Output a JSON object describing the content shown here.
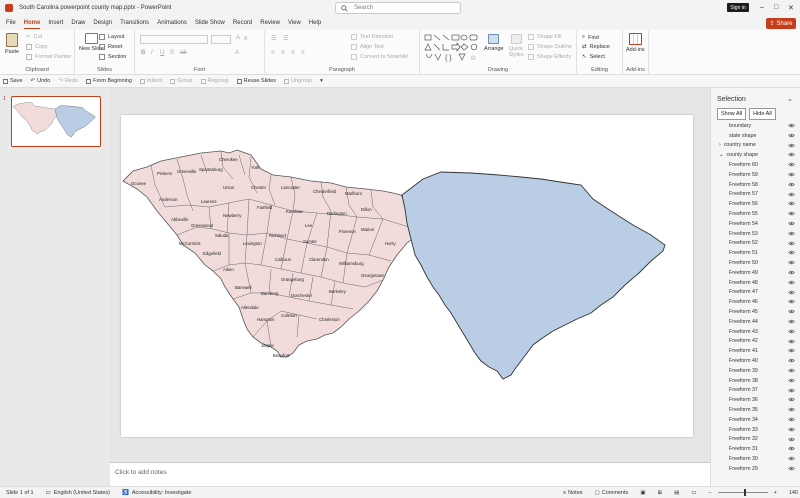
{
  "app": {
    "window_title": "South Carolina powerpoint county map.pptx  -  PowerPoint",
    "search_placeholder": "Search",
    "sign_in": "Sign in",
    "share": "Share"
  },
  "menu": [
    "File",
    "Home",
    "Insert",
    "Draw",
    "Design",
    "Transitions",
    "Animations",
    "Slide Show",
    "Record",
    "Review",
    "View",
    "Help"
  ],
  "active_menu": "Home",
  "ribbon": {
    "clipboard": {
      "label": "Clipboard",
      "paste": "Paste",
      "cut": "Cut",
      "copy": "Copy",
      "format_painter": "Format Painter"
    },
    "slides": {
      "label": "Slides",
      "new_slide": "New Slide",
      "layout": "Layout",
      "reset": "Reset",
      "section": "Section"
    },
    "font": {
      "label": "Font"
    },
    "paragraph": {
      "label": "Paragraph",
      "text_direction": "Text Direction",
      "align_text": "Align Text",
      "convert_smartart": "Convert to SmartArt"
    },
    "drawing": {
      "label": "Drawing",
      "arrange": "Arrange",
      "quick_styles": "Quick Styles",
      "shape_fill": "Shape Fill",
      "shape_outline": "Shape Outline",
      "shape_effects": "Shape Effects"
    },
    "editing": {
      "label": "Editing",
      "find": "Find",
      "replace": "Replace",
      "select": "Select"
    },
    "addins": {
      "label": "Add-ins",
      "addins": "Add-ins"
    }
  },
  "qat": {
    "save": "Save",
    "undo": "Undo",
    "redo": "Redo",
    "from_beginning": "From Beginning",
    "indent": "Indent",
    "group": "Group",
    "regroup": "Regroup",
    "reuse_slides": "Reuse Slides",
    "ungroup": "Ungroup"
  },
  "thumbnail": {
    "number": "1"
  },
  "notes_placeholder": "Click to add notes",
  "selection_pane": {
    "title": "Selection",
    "show_all": "Show All",
    "hide_all": "Hide All",
    "items": [
      {
        "label": "boundary",
        "indent": 2,
        "expander": ""
      },
      {
        "label": "state shape",
        "indent": 2,
        "expander": ""
      },
      {
        "label": "country name",
        "indent": 1,
        "expander": ">"
      },
      {
        "label": "county shape",
        "indent": 1,
        "expander": "v"
      },
      {
        "label": "Freeform 60",
        "indent": 2,
        "expander": ""
      },
      {
        "label": "Freeform 59",
        "indent": 2,
        "expander": ""
      },
      {
        "label": "Freeform 58",
        "indent": 2,
        "expander": ""
      },
      {
        "label": "Freeform 57",
        "indent": 2,
        "expander": ""
      },
      {
        "label": "Freeform 56",
        "indent": 2,
        "expander": ""
      },
      {
        "label": "Freeform 55",
        "indent": 2,
        "expander": ""
      },
      {
        "label": "Freeform 54",
        "indent": 2,
        "expander": ""
      },
      {
        "label": "Freeform 53",
        "indent": 2,
        "expander": ""
      },
      {
        "label": "Freeform 52",
        "indent": 2,
        "expander": ""
      },
      {
        "label": "Freeform 51",
        "indent": 2,
        "expander": ""
      },
      {
        "label": "Freeform 50",
        "indent": 2,
        "expander": ""
      },
      {
        "label": "Freeform 49",
        "indent": 2,
        "expander": ""
      },
      {
        "label": "Freeform 48",
        "indent": 2,
        "expander": ""
      },
      {
        "label": "Freeform 47",
        "indent": 2,
        "expander": ""
      },
      {
        "label": "Freeform 46",
        "indent": 2,
        "expander": ""
      },
      {
        "label": "Freeform 45",
        "indent": 2,
        "expander": ""
      },
      {
        "label": "Freeform 44",
        "indent": 2,
        "expander": ""
      },
      {
        "label": "Freeform 43",
        "indent": 2,
        "expander": ""
      },
      {
        "label": "Freeform 42",
        "indent": 2,
        "expander": ""
      },
      {
        "label": "Freeform 41",
        "indent": 2,
        "expander": ""
      },
      {
        "label": "Freeform 40",
        "indent": 2,
        "expander": ""
      },
      {
        "label": "Freeform 39",
        "indent": 2,
        "expander": ""
      },
      {
        "label": "Freeform 38",
        "indent": 2,
        "expander": ""
      },
      {
        "label": "Freeform 37",
        "indent": 2,
        "expander": ""
      },
      {
        "label": "Freeform 36",
        "indent": 2,
        "expander": ""
      },
      {
        "label": "Freeform 35",
        "indent": 2,
        "expander": ""
      },
      {
        "label": "Freeform 34",
        "indent": 2,
        "expander": ""
      },
      {
        "label": "Freeform 33",
        "indent": 2,
        "expander": ""
      },
      {
        "label": "Freeform 32",
        "indent": 2,
        "expander": ""
      },
      {
        "label": "Freeform 31",
        "indent": 2,
        "expander": ""
      },
      {
        "label": "Freeform 30",
        "indent": 2,
        "expander": ""
      },
      {
        "label": "Freeform 29",
        "indent": 2,
        "expander": ""
      }
    ]
  },
  "status": {
    "slide": "Slide 1 of 1",
    "language": "English (United States)",
    "accessibility": "Accessibility: Investigate",
    "notes": "Notes",
    "comments": "Comments",
    "zoom": "140"
  },
  "map": {
    "county_fill": "#f2dcdb",
    "state_fill": "#b9cde5",
    "counties": [
      "Oconee",
      "Pickens",
      "Greenville",
      "Cherokee",
      "Spartanburg",
      "York",
      "Union",
      "Chester",
      "Lancaster",
      "Chesterfield",
      "Marlboro",
      "Anderson",
      "Laurens",
      "Abbeville",
      "Greenwood",
      "Newberry",
      "Fairfield",
      "Kershaw",
      "Darlington",
      "Dillon",
      "Lee",
      "Florence",
      "Marion",
      "Horry",
      "Saluda",
      "Lexington",
      "Richland",
      "Sumter",
      "McCormick",
      "Edgefield",
      "Calhoun",
      "Clarendon",
      "Williamsburg",
      "Aiken",
      "Orangeburg",
      "Georgetown",
      "Barnwell",
      "Bamberg",
      "Dorchester",
      "Berkeley",
      "Allendale",
      "Hampton",
      "Colleton",
      "Charleston",
      "Jasper",
      "Beaufort"
    ]
  }
}
